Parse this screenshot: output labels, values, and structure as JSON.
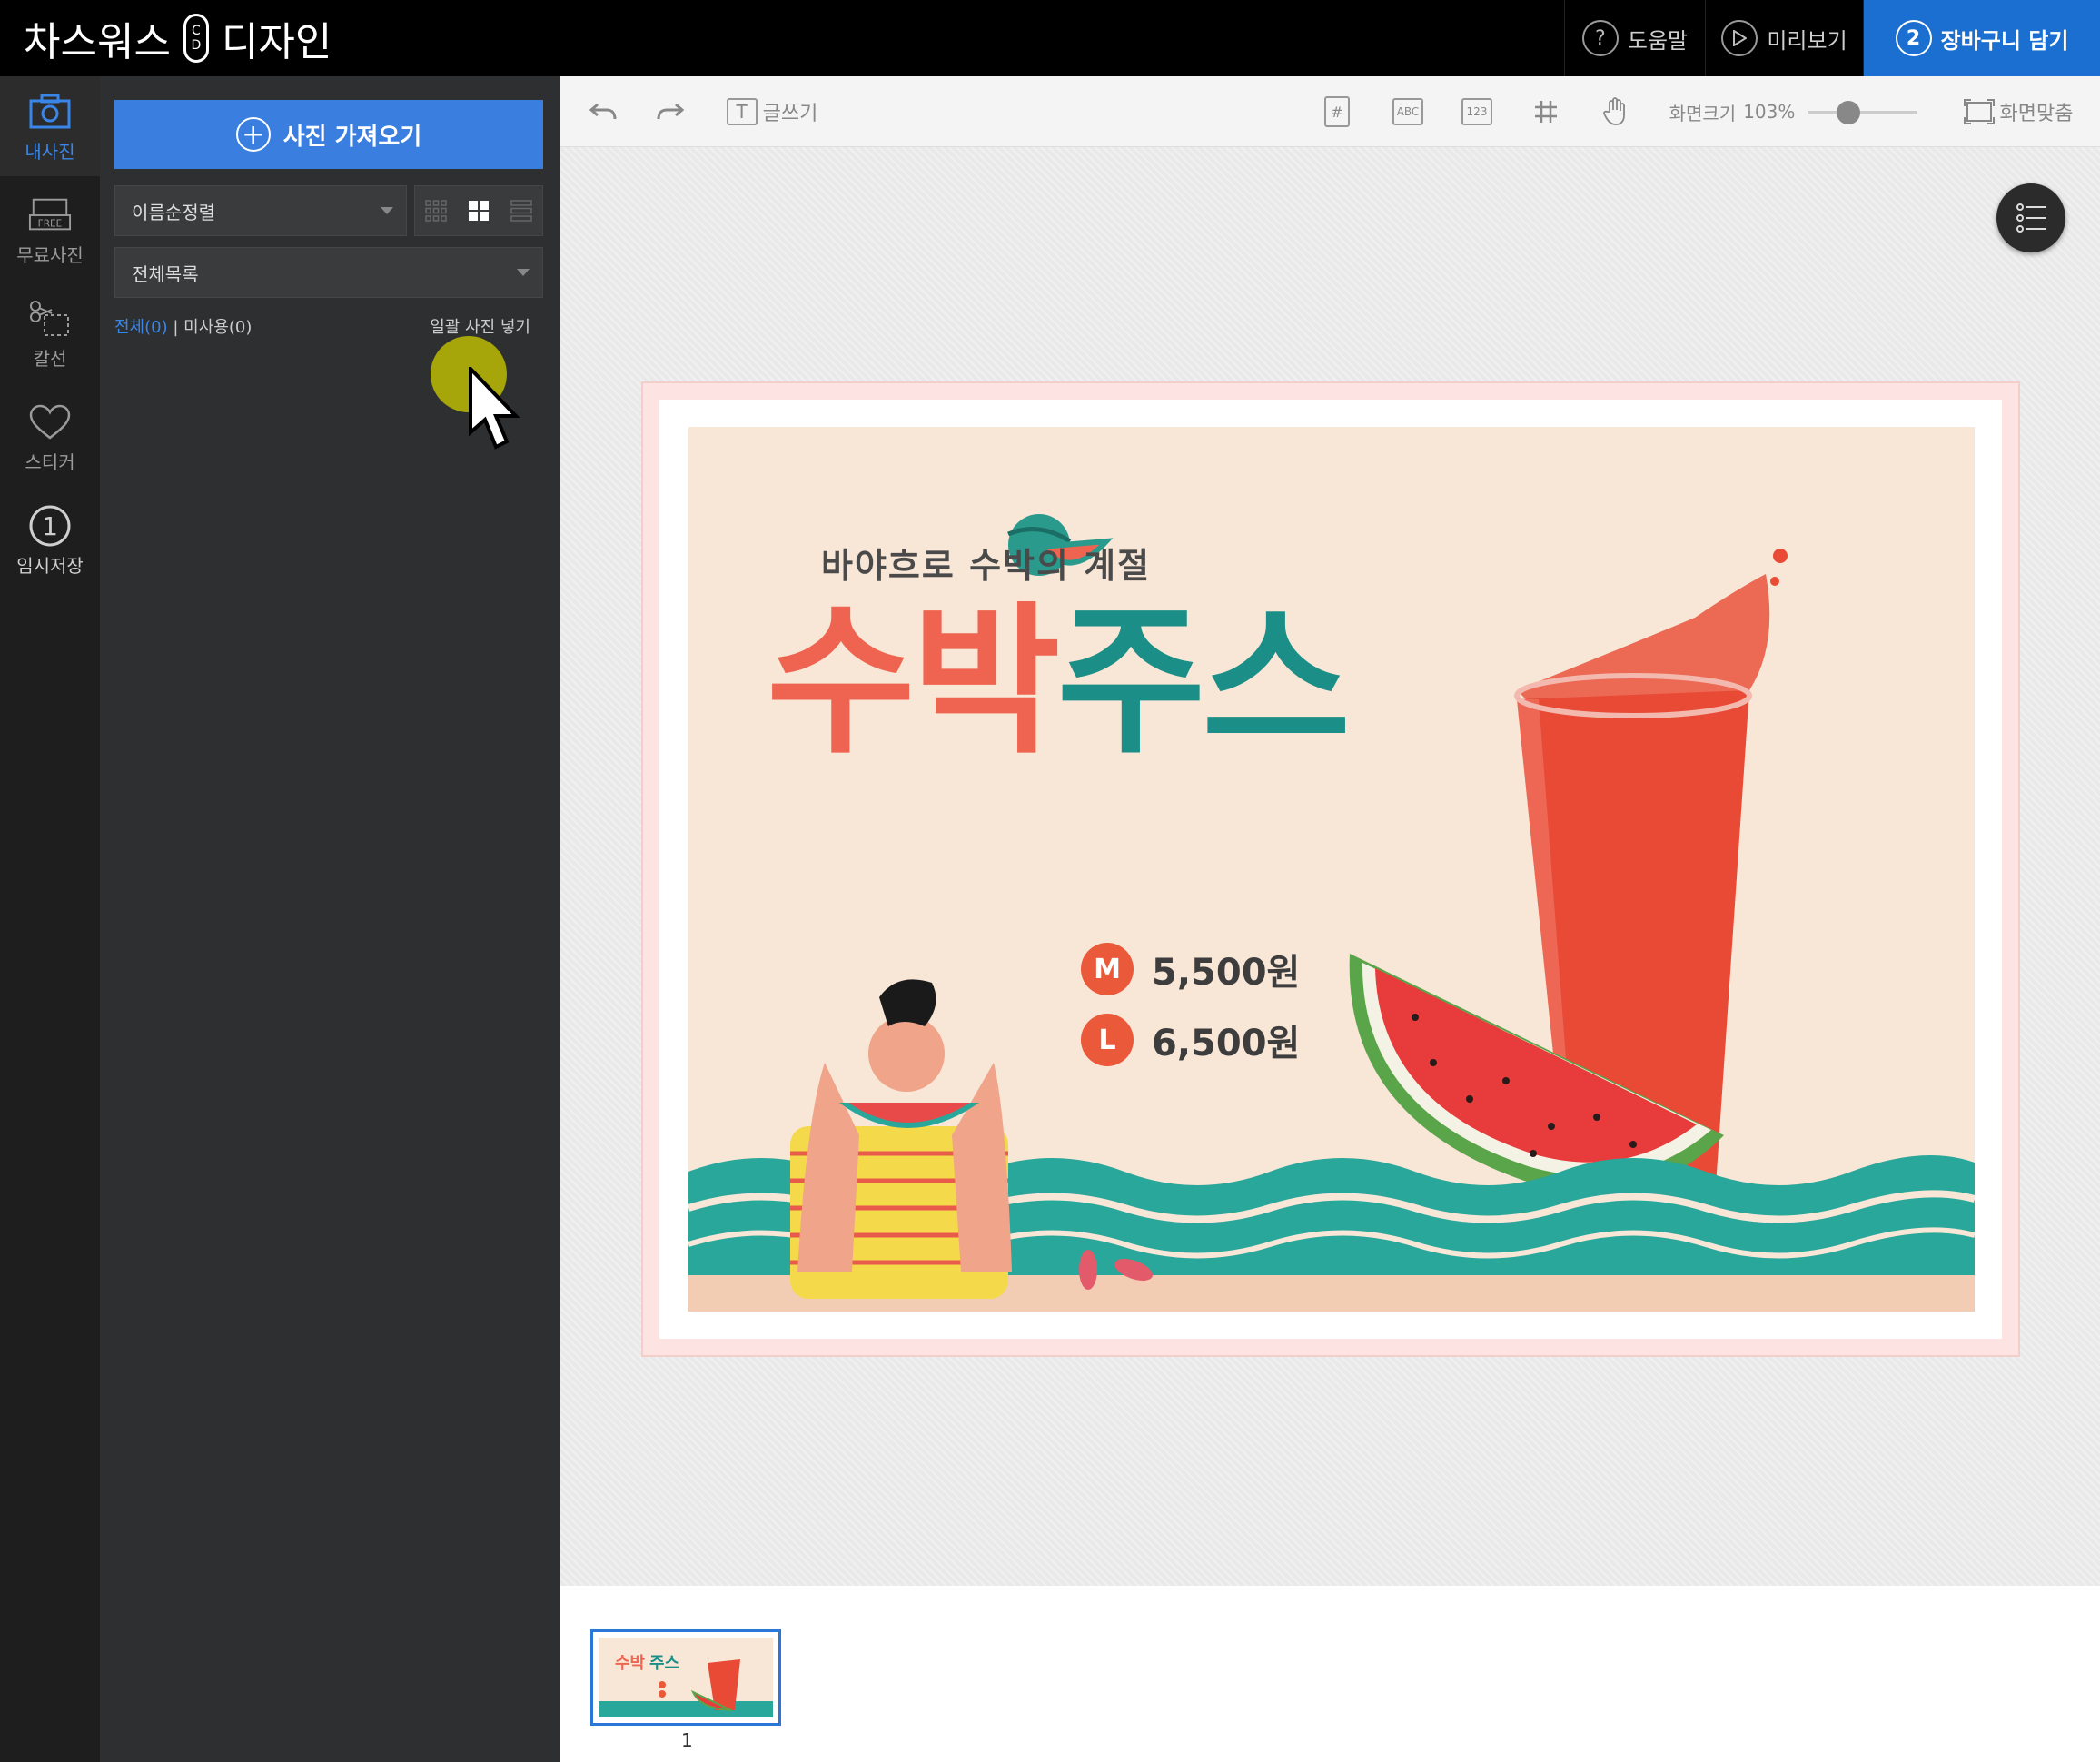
{
  "app": {
    "brand_left": "차스워스",
    "brand_mark_top": "C",
    "brand_mark_bottom": "D",
    "brand_right": "디자인"
  },
  "topnav": {
    "help": {
      "label": "도움말",
      "icon": "question-icon"
    },
    "preview": {
      "label": "미리보기",
      "icon": "play-icon"
    },
    "cart": {
      "label": "장바구니 담기",
      "step": "2",
      "color": "#1b6fd1"
    }
  },
  "rail": {
    "items": [
      {
        "label": "내사진",
        "icon": "camera-icon",
        "active": true
      },
      {
        "label": "무료사진",
        "icon": "free-photo-icon"
      },
      {
        "label": "칼선",
        "icon": "scissors-icon"
      },
      {
        "label": "스티커",
        "icon": "heart-icon"
      },
      {
        "label": "임시저장",
        "icon": "save-draft-icon",
        "badge": "1"
      }
    ]
  },
  "panel": {
    "import_label": "사진 가져오기",
    "sort_value": "이름순정렬",
    "folder_value": "전체목록",
    "filter_all": "전체(0)",
    "filter_separator": "|",
    "filter_unused": "미사용(0)",
    "bulk_insert": "일괄 사진 넣기"
  },
  "toolbar": {
    "text_tool": "글쓰기",
    "text_box_glyph": "T",
    "zoom_label": "화면크기",
    "zoom_value": "103%",
    "zoom_level_percent": 103,
    "fit_label": "화면맞춤",
    "icons": [
      "undo-icon",
      "redo-icon",
      "text-icon",
      "page-number-icon",
      "abc-icon",
      "numbering-icon",
      "grid-icon",
      "hand-icon",
      "fit-screen-icon"
    ],
    "box_labels": {
      "page": "#",
      "abc": "ABC",
      "num": "123"
    }
  },
  "poster": {
    "subtitle": "바야흐로 수박의 계절",
    "title_part1": "수박",
    "title_part2": "주스",
    "prices": [
      {
        "size": "M",
        "price": "5,500원"
      },
      {
        "size": "L",
        "price": "6,500원"
      }
    ],
    "colors": {
      "coral": "#ef6450",
      "teal": "#1b8f87",
      "background": "#f8e6d6"
    }
  },
  "pages": {
    "items": [
      {
        "number": "1",
        "selected": true
      }
    ]
  }
}
